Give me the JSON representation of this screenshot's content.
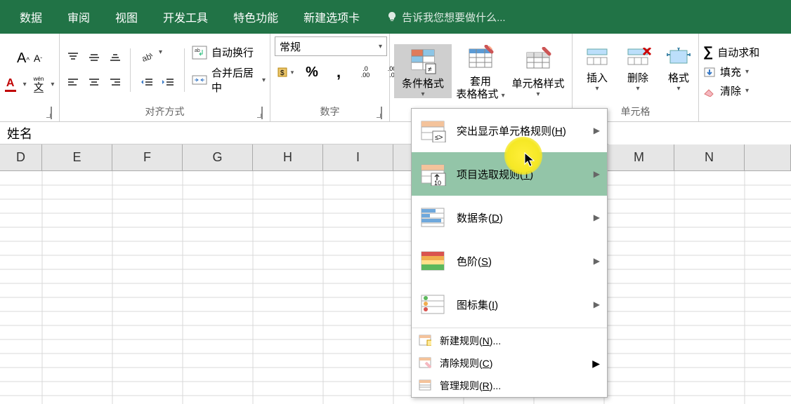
{
  "tabs": {
    "items": [
      "数据",
      "审阅",
      "视图",
      "开发工具",
      "特色功能",
      "新建选项卡"
    ],
    "tell_me_placeholder": "告诉我您想要做什么..."
  },
  "ribbon": {
    "font": {
      "title": ""
    },
    "align": {
      "title": "对齐方式",
      "wrap_label": "自动换行",
      "merge_label": "合并后居中"
    },
    "number": {
      "title": "数字",
      "format_value": "常规",
      "percent": "%",
      "comma": ",",
      "dec_inc": ".00",
      "dec_dec": ".00"
    },
    "styles": {
      "cond_format_label": "条件格式",
      "table_format_label_1": "套用",
      "table_format_label_2": "表格格式",
      "cell_styles_label": "单元格样式"
    },
    "cells": {
      "title": "单元格",
      "insert_label": "插入",
      "delete_label": "删除",
      "format_label": "格式"
    },
    "editing": {
      "autosum_label": "自动求和",
      "fill_label": "填充",
      "clear_label": "清除"
    }
  },
  "formula_bar": {
    "value": "姓名"
  },
  "columns": [
    "D",
    "E",
    "F",
    "G",
    "H",
    "I",
    "",
    "",
    "",
    "M",
    "N",
    ""
  ],
  "cf_menu": {
    "items": [
      {
        "label": "突出显示单元格规则(",
        "key": "H",
        "tail": ")",
        "has_sub": true
      },
      {
        "label": "项目选取规则(",
        "key": "T",
        "tail": ")",
        "has_sub": true,
        "highlight": true
      },
      {
        "label": "数据条(",
        "key": "D",
        "tail": ")",
        "has_sub": true
      },
      {
        "label": "色阶(",
        "key": "S",
        "tail": ")",
        "has_sub": true
      },
      {
        "label": "图标集(",
        "key": "I",
        "tail": ")",
        "has_sub": true
      }
    ],
    "small_items": [
      {
        "label": "新建规则(",
        "key": "N",
        "tail": ")..."
      },
      {
        "label": "清除规则(",
        "key": "C",
        "tail": ")",
        "has_sub": true
      },
      {
        "label": "管理规则(",
        "key": "R",
        "tail": ")..."
      }
    ]
  },
  "colors": {
    "excel_green": "#217346",
    "highlight_green": "#93c5a8",
    "red_underline": "#c00000"
  }
}
